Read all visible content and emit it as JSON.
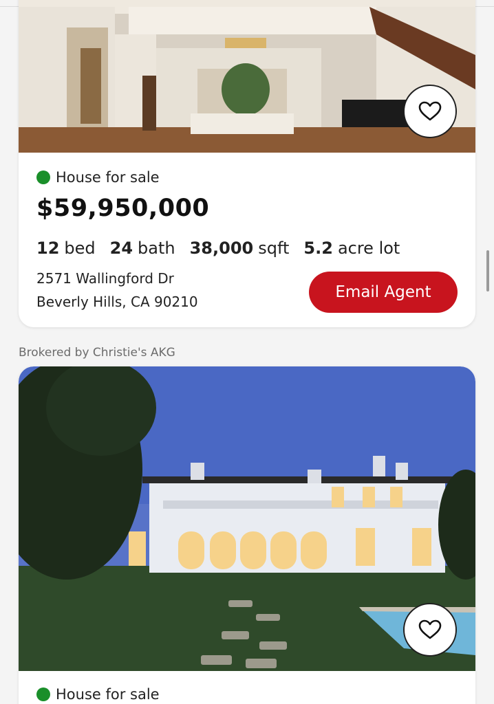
{
  "listings": [
    {
      "status": "House for sale",
      "status_color": "#1a8f2a",
      "price": "$59,950,000",
      "specs": [
        {
          "value": "12",
          "unit": "bed"
        },
        {
          "value": "24",
          "unit": "bath"
        },
        {
          "value": "38,000",
          "unit": "sqft"
        },
        {
          "value": "5.2",
          "unit": "acre lot"
        }
      ],
      "address_line1": "2571 Wallingford Dr",
      "address_line2": "Beverly Hills, CA 90210",
      "cta_label": "Email Agent",
      "favorite_icon": "heart-outline-icon"
    },
    {
      "broker": "Brokered by Christie's AKG",
      "status": "House for sale",
      "status_color": "#1a8f2a",
      "favorite_icon": "heart-outline-icon"
    }
  ],
  "colors": {
    "accent": "#c8141e",
    "text": "#111111",
    "muted": "#6b6b6b"
  }
}
